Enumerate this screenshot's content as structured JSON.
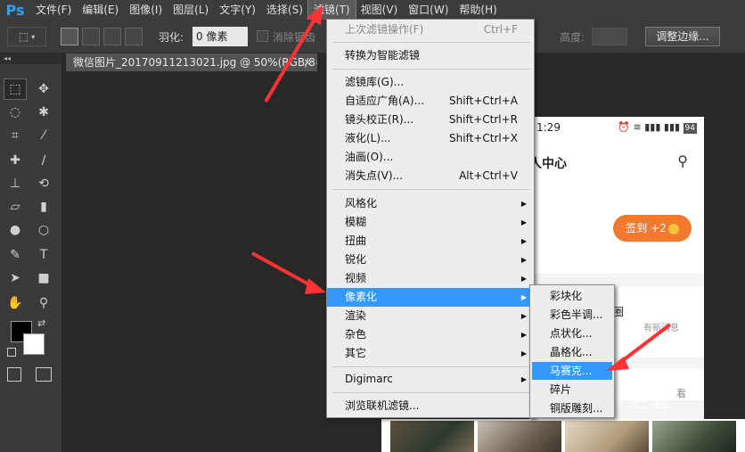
{
  "app": {
    "logo": "Ps"
  },
  "menubar": {
    "items": [
      "文件(F)",
      "编辑(E)",
      "图像(I)",
      "图层(L)",
      "文字(Y)",
      "选择(S)",
      "滤镜(T)",
      "视图(V)",
      "窗口(W)",
      "帮助(H)"
    ],
    "active": "滤镜(T)"
  },
  "options": {
    "feather_label": "羽化:",
    "feather_value": "0 像素",
    "antialias_label": "消除锯齿",
    "height_label": "高度:",
    "refine_edge": "调整边缘..."
  },
  "toolbox": {
    "collapse": "◂◂"
  },
  "document": {
    "tab_title": "微信图片_20170911213021.jpg @ 50%(RGB/8#)",
    "close": "×"
  },
  "phone": {
    "time": "1:29",
    "battery": "94",
    "title": "人中心",
    "signin": "签到 +2",
    "circle": "圈",
    "news": "有新消息",
    "more": "看"
  },
  "filter_menu": {
    "items": [
      {
        "label": "上次滤镜操作(F)",
        "shortcut": "Ctrl+F",
        "disabled": true
      },
      {
        "label": "转换为智能滤镜"
      },
      {
        "label": "滤镜库(G)..."
      },
      {
        "label": "自适应广角(A)...",
        "shortcut": "Shift+Ctrl+A"
      },
      {
        "label": "镜头校正(R)...",
        "shortcut": "Shift+Ctrl+R"
      },
      {
        "label": "液化(L)...",
        "shortcut": "Shift+Ctrl+X"
      },
      {
        "label": "油画(O)..."
      },
      {
        "label": "消失点(V)...",
        "shortcut": "Alt+Ctrl+V"
      },
      {
        "label": "风格化"
      },
      {
        "label": "模糊"
      },
      {
        "label": "扭曲"
      },
      {
        "label": "锐化"
      },
      {
        "label": "视频"
      },
      {
        "label": "像素化",
        "highlighted": true
      },
      {
        "label": "渲染"
      },
      {
        "label": "杂色"
      },
      {
        "label": "其它"
      },
      {
        "label": "Digimarc"
      },
      {
        "label": "浏览联机滤镜..."
      }
    ]
  },
  "pixelate_submenu": {
    "items": [
      "彩块化",
      "彩色半调...",
      "点状化...",
      "晶格化...",
      "马赛克...",
      "碎片",
      "铜版雕刻..."
    ],
    "highlighted": "马赛克..."
  },
  "watermark": {
    "text": "Bai 经验",
    "sub": "jingyan.baidu.com"
  },
  "colors": {
    "menu_highlight": "#3399ff",
    "arrow": "#ff3333",
    "ps_blue": "#2fa3f7",
    "signin": "#f27a2e"
  }
}
